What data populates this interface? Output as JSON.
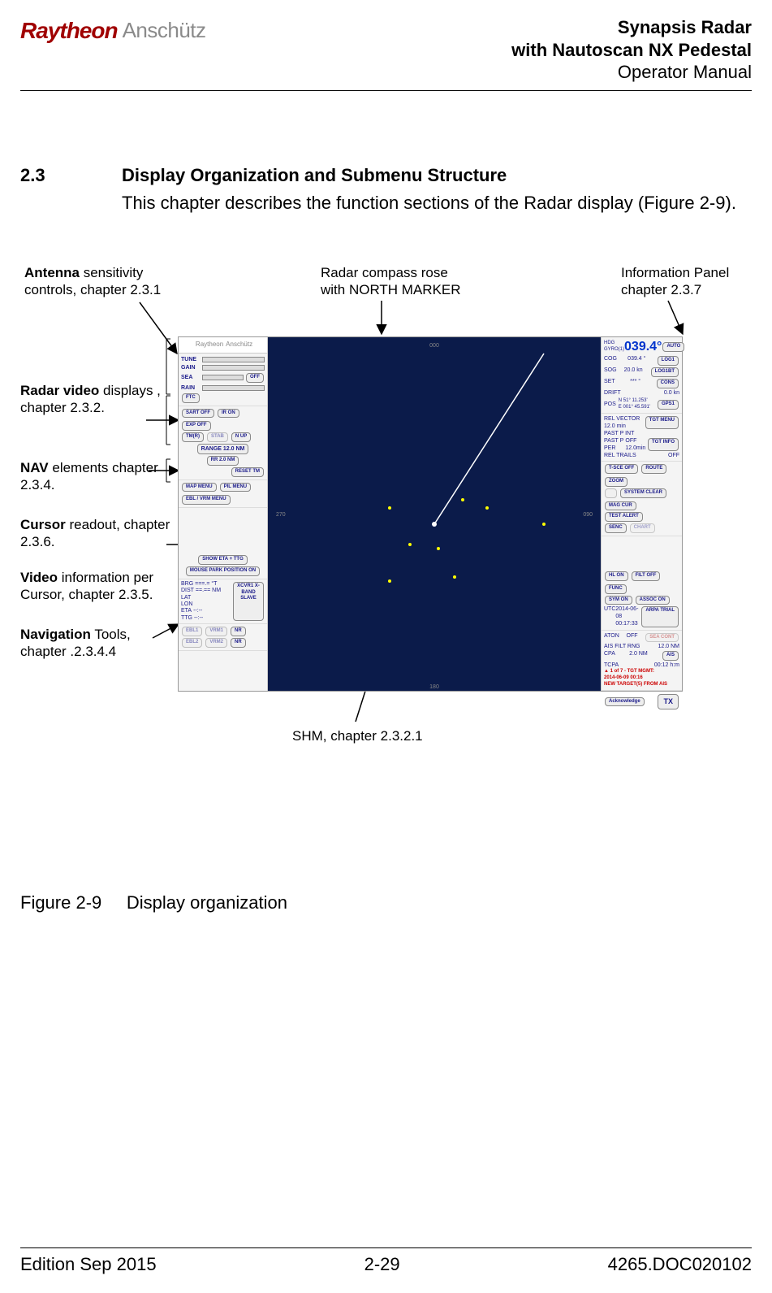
{
  "header": {
    "logo_raytheon": "Raytheon",
    "logo_anschutz": "Anschütz",
    "title_line1": "Synapsis Radar",
    "title_line2": "with Nautoscan NX Pedestal",
    "title_line3": "Operator Manual"
  },
  "section": {
    "number": "2.3",
    "title": "Display Organization and Submenu Structure",
    "body": "This chapter describes the function sections of the Radar display (Figure 2-9)."
  },
  "callouts": {
    "antenna": {
      "bold": "Antenna",
      "rest": " sensitivity controls, chapter 2.3.1"
    },
    "compass": {
      "line1": "Radar compass rose",
      "line2": "with NORTH MARKER"
    },
    "info": {
      "line1": "Information Panel",
      "line2": "chapter 2.3.7"
    },
    "video": {
      "bold": "Radar video",
      "rest": " displays , chapter 2.3.2."
    },
    "nav": {
      "bold": "NAV",
      "rest": " elements chapter 2.3.4."
    },
    "cursor": {
      "bold": "Cursor",
      "rest": " readout, chapter 2.3.6."
    },
    "videoinfo": {
      "bold": "Video",
      "rest": " information per Cursor, chapter 2.3.5."
    },
    "navtools": {
      "bold": "Navigation",
      "rest": " Tools, chapter .2.3.4.4"
    },
    "shm": "SHM, chapter 2.3.2.1"
  },
  "radar_ui": {
    "tune": "TUNE",
    "gain": "GAIN",
    "sea": "SEA",
    "rain": "RAIN",
    "off": "OFF",
    "ftc": "FTC",
    "sart_off": "SART OFF",
    "ir_on": "IR ON",
    "exp_off": "EXP OFF",
    "tmr": "TM(R)",
    "stab": "STAB",
    "nup": "N UP",
    "range": "RANGE 12.0 NM",
    "rr": "RR 2.0 NM",
    "reset_tm": "RESET TM",
    "map_menu": "MAP MENU",
    "pil_menu": "PIL MENU",
    "ebl_vrm": "EBL / VRM MENU",
    "show_eta": "SHOW ETA + TTG",
    "mouse_park": "MOUSE PARK POSITION ON",
    "brg": "BRG",
    "dist": "DIST",
    "lat": "LAT",
    "lon": "LON",
    "eta": "ETA",
    "ttg": "TTG",
    "brg_val": "===.= °T",
    "dist_val": "==.== NM",
    "val_dash": "--:--",
    "xcvr": "XCVR1 X-BAND SLAVE",
    "ebl1": "EBL1",
    "vrm1": "VRM1",
    "nr": "NR",
    "ebl2": "EBL2",
    "vrm2": "VRM2",
    "hdg": "HDG",
    "hdg_val": "039.4°",
    "gyro": "GYRO(1)",
    "auto": "AUTO",
    "cog": "COG",
    "cog_val": "039.4 °",
    "log1": "LOG1",
    "sog": "SOG",
    "sog_val": "20.0 kn",
    "log1bt": "LOG1BT",
    "set": "SET",
    "set_val": "*** °",
    "cons": "CONS",
    "drift": "DRIFT",
    "drift_val": "0.0   kn",
    "pos": "POS",
    "pos_val1": "N 51° 11.253'",
    "pos_val2": "E 001° 45.591'",
    "gps1": "GPS1",
    "rel_vector": "REL  VECTOR   12.0  min",
    "tgt_menu": "TGT MENU",
    "past_pint": "PAST P INT",
    "past_p_per": "PAST P PER",
    "off_12min": "OFF 12.0min",
    "tgt_info": "TGT INFO",
    "rel_trails": "REL TRAILS",
    "off2": "OFF",
    "t_sce_off": "T-SCE OFF",
    "route": "ROUTE",
    "zoom": "ZOOM",
    "system_clear": "SYSTEM CLEAR",
    "mag_cur": "MAG CUR",
    "test_alert": "TEST ALERT",
    "senc": "SENC",
    "chart": "CHART",
    "hl_on": "HL ON",
    "filt_off": "FILT OFF",
    "func": "FUNC",
    "sym_on": "SYM ON",
    "assoc_on": "ASSOC ON",
    "utc": "UTC",
    "utc_val": "2014-06-08  00:17:33",
    "arpa_trial": "ARPA TRIAL",
    "aton": "ATON",
    "aton_off": "OFF",
    "ais_filt": "AIS FILT RNG",
    "ais_rng": "12.0   NM",
    "cpa": "CPA",
    "cpa_val": "2.0   NM",
    "tcpa": "TCPA",
    "tcpa_val": "00:12 h:m",
    "ais": "AIS",
    "alert1": "1 of 7 - TGT MGMT:",
    "alert2": "2014-06-09 00:16",
    "alert3": "NEW TARGET(5) FROM AIS",
    "ack": "Acknowledge",
    "tx": "TX",
    "sea_cont": "SEA CONT"
  },
  "figure_caption": {
    "num": "Figure 2-9",
    "text": "Display organization"
  },
  "footer": {
    "left": "Edition Sep 2015",
    "center": "2-29",
    "right": "4265.DOC020102"
  }
}
